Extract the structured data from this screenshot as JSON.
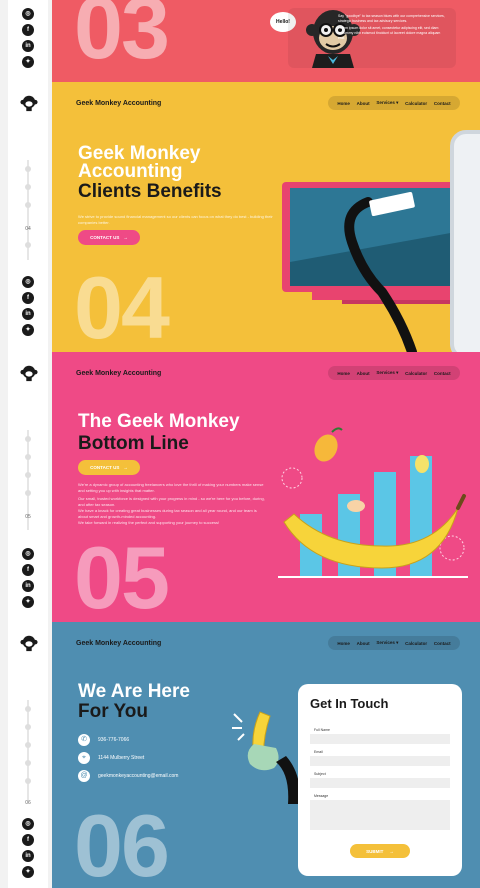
{
  "rail": {
    "social_icons": [
      "instagram-icon",
      "facebook-icon",
      "linkedin-icon",
      "twitter-icon"
    ],
    "section_numbers": [
      "04",
      "05",
      "06"
    ]
  },
  "nav": {
    "brand": "Geek Monkey Accounting",
    "items": [
      "Home",
      "About",
      "Services",
      "Calculator",
      "Contact"
    ]
  },
  "section03": {
    "number": "03",
    "speech": "Hello!",
    "paragraph": "Say \"goodbye\" to tax season blues with our comprehensive services, strategic business and tax advisory services.",
    "paragraph2": "Lorem ipsum dolor sit amet, consectetur adipiscing elit, sed diam nonummy nibh euismod tincidunt ut laoreet dolore magna aliquam erat."
  },
  "section04": {
    "title_line1": "Geek Monkey",
    "title_line2": "Accounting",
    "title_line3": "Clients Benefits",
    "body": "We strive to provide sound financial management so our clients can focus on what they do best - building their companies better.",
    "cta": "CONTACT US",
    "number": "04"
  },
  "section05": {
    "title_line1": "The Geek Monkey",
    "title_line2": "Bottom Line",
    "cta": "CONTACT US",
    "body1": "We're a dynamic group of accounting freelancers who love the thrill of making your numbers make sense and setting you up with insights that matter.",
    "body2": "Our small, trusted workforce is designed with your progress in mind - so we're here for you before, during, and after tax season.",
    "body3": "We have a knack for creating great businesses during tax season and all year round, and our team is about smart and growth-minded accounting.",
    "body4": "We take forward in realizing the perfect and supporting your journey to success!",
    "number": "05"
  },
  "section06": {
    "title_line1": "We Are Here",
    "title_line2": "For You",
    "phone": "936-776-7066",
    "address": "1144 Mulberry Street",
    "email": "geekmonkeyaccounting@email.com",
    "number": "06",
    "form": {
      "title": "Get In Touch",
      "fields": [
        "Full Name",
        "Email",
        "Subject",
        "Message"
      ],
      "submit": "SUBMIT"
    }
  },
  "colors": {
    "red": "#ef5b64",
    "yellow": "#f4c03a",
    "pink": "#ef4a86",
    "blue": "#4f8eb1",
    "dark": "#1a1a1a"
  }
}
